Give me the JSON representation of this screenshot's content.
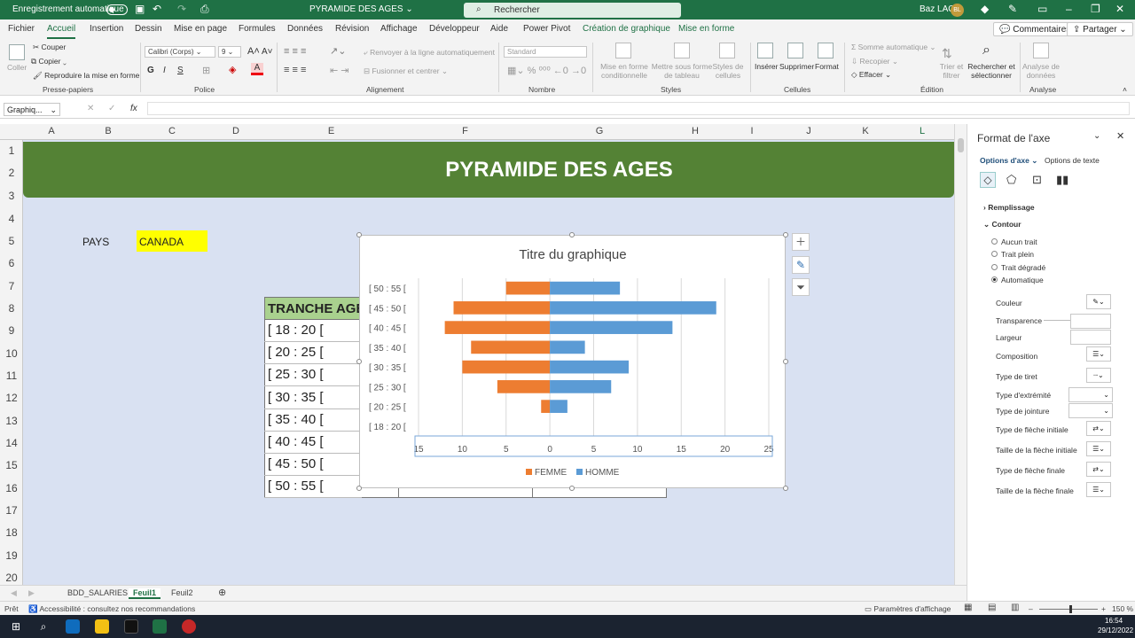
{
  "titlebar": {
    "autosave": "Enregistrement automatique",
    "filename": "PYRAMIDE DES AGES",
    "search": "Rechercher",
    "user": "Baz LAG",
    "initials": "BL"
  },
  "tabs": [
    "Fichier",
    "Accueil",
    "Insertion",
    "Dessin",
    "Mise en page",
    "Formules",
    "Données",
    "Révision",
    "Affichage",
    "Développeur",
    "Aide",
    "Power Pivot",
    "Création de graphique",
    "Mise en forme"
  ],
  "tab_buttons": {
    "comments": "Commentaires",
    "share": "Partager"
  },
  "ribbon": {
    "clipboard": {
      "paste": "Coller",
      "cut": "Couper",
      "copy": "Copier",
      "painter": "Reproduire la mise en forme",
      "group": "Presse-papiers"
    },
    "font": {
      "name": "Calibri (Corps)",
      "size": "9",
      "group": "Police",
      "bold": "G",
      "italic": "I",
      "underline": "S"
    },
    "alignment": {
      "wrap": "Renvoyer à la ligne automatiquement",
      "merge": "Fusionner et centrer",
      "group": "Alignement"
    },
    "number": {
      "format": "Standard",
      "group": "Nombre"
    },
    "styles": {
      "cond": "Mise en forme conditionnelle",
      "table": "Mettre sous forme de tableau",
      "cell": "Styles de cellules",
      "group": "Styles"
    },
    "cells": {
      "insert": "Insérer",
      "delete": "Supprimer",
      "format": "Format",
      "group": "Cellules"
    },
    "editing": {
      "autosum": "Somme automatique",
      "fill": "Recopier",
      "clear": "Effacer",
      "sort": "Trier et filtrer",
      "find": "Rechercher et sélectionner",
      "group": "Édition"
    },
    "analysis": {
      "analyze": "Analyse de données",
      "group": "Analyse"
    }
  },
  "namebox": "Graphiq...",
  "columns": [
    "A",
    "B",
    "C",
    "D",
    "E",
    "F",
    "G",
    "H",
    "I",
    "J",
    "K",
    "L"
  ],
  "rows": [
    "1",
    "2",
    "3",
    "4",
    "5",
    "6",
    "7",
    "8",
    "9",
    "10",
    "11",
    "12",
    "13",
    "14",
    "15",
    "16",
    "17",
    "18",
    "19",
    "20"
  ],
  "sheet": {
    "banner": "PYRAMIDE DES AGES",
    "pays_label": "PAYS",
    "pays_value": "CANADA",
    "table_header": "TRANCHE AGE",
    "table_rows": [
      "[ 18 : 20 [",
      "[ 20 : 25 [",
      "[ 25 : 30 [",
      "[ 30 : 35 [",
      "[ 35 : 40 [",
      "[ 40 : 45 [",
      "[ 45 : 50 [",
      "[ 50 : 55 ["
    ]
  },
  "chart_data": {
    "type": "bar",
    "orientation": "horizontal",
    "title": "Titre du graphique",
    "categories": [
      "[ 18 : 20 [",
      "[ 20 : 25 [",
      "[ 25 : 30 [",
      "[ 30 : 35 [",
      "[ 35 : 40 [",
      "[ 40 : 45 [",
      "[ 45 : 50 [",
      "[ 50 : 55 ["
    ],
    "series": [
      {
        "name": "FEMME",
        "color": "#ed7d31",
        "values": [
          0,
          1,
          6,
          10,
          9,
          12,
          11,
          5
        ]
      },
      {
        "name": "HOMME",
        "color": "#5b9bd5",
        "values": [
          0,
          2,
          7,
          9,
          4,
          14,
          19,
          8
        ]
      }
    ],
    "xlim": [
      -15,
      25
    ],
    "xticks": [
      -15,
      -10,
      -5,
      0,
      5,
      10,
      15,
      20,
      25
    ],
    "xtick_labels": [
      "15",
      "10",
      "5",
      "0",
      "5",
      "10",
      "15",
      "20",
      "25"
    ],
    "grid": true,
    "legend": "bottom"
  },
  "sheettabs": [
    "BDD_SALARIES",
    "Feuil1",
    "Feuil2"
  ],
  "status": {
    "ready": "Prêt",
    "access": "Accessibilité : consultez nos recommandations",
    "display": "Paramètres d'affichage",
    "zoom": "150 %"
  },
  "taskbar": {
    "time": "16:54",
    "date": "29/12/2022"
  },
  "pane": {
    "title": "Format de l'axe",
    "tab_axis": "Options d'axe",
    "tab_text": "Options de texte",
    "fill": "Remplissage",
    "line": "Contour",
    "radios": [
      "Aucun trait",
      "Trait plein",
      "Trait dégradé",
      "Automatique"
    ],
    "props": [
      "Couleur",
      "Transparence",
      "Largeur",
      "Composition",
      "Type de tiret",
      "Type d'extrémité",
      "Type de jointure",
      "Type de flèche initiale",
      "Taille de la flèche initiale",
      "Type de flèche finale",
      "Taille de la flèche finale"
    ]
  }
}
